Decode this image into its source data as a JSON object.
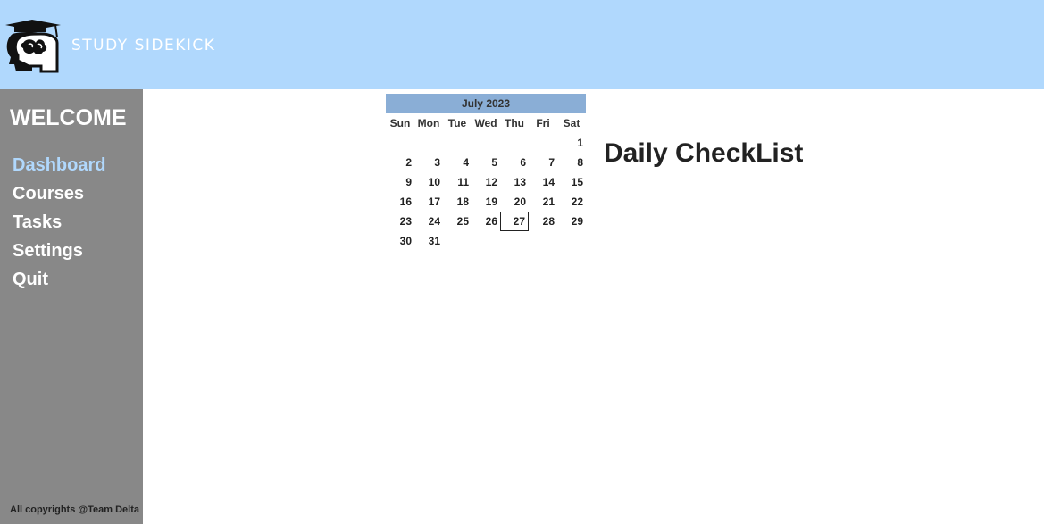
{
  "app": {
    "brand": "STUDY SIDEKICK",
    "logo_icon": "graduate-head-icon"
  },
  "sidebar": {
    "welcome": "WELCOME",
    "items": [
      {
        "label": "Dashboard",
        "active": true
      },
      {
        "label": "Courses",
        "active": false
      },
      {
        "label": "Tasks",
        "active": false
      },
      {
        "label": "Settings",
        "active": false
      },
      {
        "label": "Quit",
        "active": false
      }
    ],
    "copyright": "All copyrights @Team Delta"
  },
  "calendar": {
    "month_label": "July 2023",
    "weekdays": [
      "Sun",
      "Mon",
      "Tue",
      "Wed",
      "Thu",
      "Fri",
      "Sat"
    ],
    "first_weekday_index": 6,
    "days": [
      "1",
      "2",
      "3",
      "4",
      "5",
      "6",
      "7",
      "8",
      "9",
      "10",
      "11",
      "12",
      "13",
      "14",
      "15",
      "16",
      "17",
      "18",
      "19",
      "20",
      "21",
      "22",
      "23",
      "24",
      "25",
      "26",
      "27",
      "28",
      "29",
      "30",
      "31"
    ],
    "selected_day": "27"
  },
  "main": {
    "checklist_title": "Daily CheckList"
  },
  "colors": {
    "header_bg": "#b0d8fd",
    "sidebar_bg": "#888888",
    "active_nav": "#b0d8fd",
    "calendar_header_bg": "#8aaed6"
  }
}
